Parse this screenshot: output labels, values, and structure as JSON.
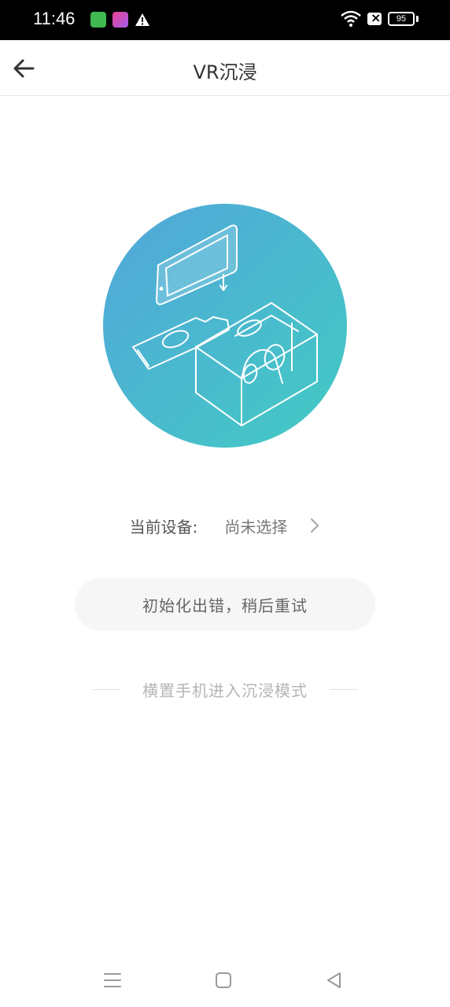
{
  "status_bar": {
    "time": "11:46",
    "battery": "95",
    "icons": [
      "notification-app-icon",
      "notification-pen-icon",
      "warning-icon",
      "wifi-icon",
      "no-sim-icon",
      "battery-icon"
    ]
  },
  "app_bar": {
    "title": "VR沉浸",
    "back_icon": "back-arrow-icon"
  },
  "hero": {
    "icon": "vr-cardboard-illustration",
    "gradient_start": "#4fa8d8",
    "gradient_end": "#43c8c2"
  },
  "device": {
    "label": "当前设备:",
    "value": "尚未选择",
    "chevron_icon": "chevron-right-icon"
  },
  "status": {
    "message": "初始化出错，稍后重试"
  },
  "hint": {
    "text": "横置手机进入沉浸模式"
  },
  "nav_bar": {
    "icons": [
      "menu-icon",
      "home-icon",
      "back-triangle-icon"
    ]
  }
}
